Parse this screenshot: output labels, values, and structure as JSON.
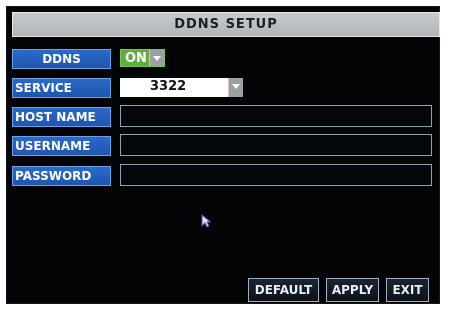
{
  "title": "DDNS SETUP",
  "fields": {
    "ddns": {
      "label": "DDNS",
      "value": "ON"
    },
    "service": {
      "label": "SERVICE",
      "value": "3322"
    },
    "host_name": {
      "label": "HOST NAME",
      "value": ""
    },
    "username": {
      "label": "USERNAME",
      "value": ""
    },
    "password": {
      "label": "PASSWORD",
      "value": ""
    }
  },
  "buttons": {
    "default": "DEFAULT",
    "apply": "APPLY",
    "exit": "EXIT"
  },
  "colors": {
    "label_bg": "#1f56ad",
    "on_bg": "#5fae3c",
    "screen_bg": "#020406"
  },
  "icons": {
    "cursor": "mouse-pointer-icon",
    "dropdown": "chevron-down-icon"
  }
}
